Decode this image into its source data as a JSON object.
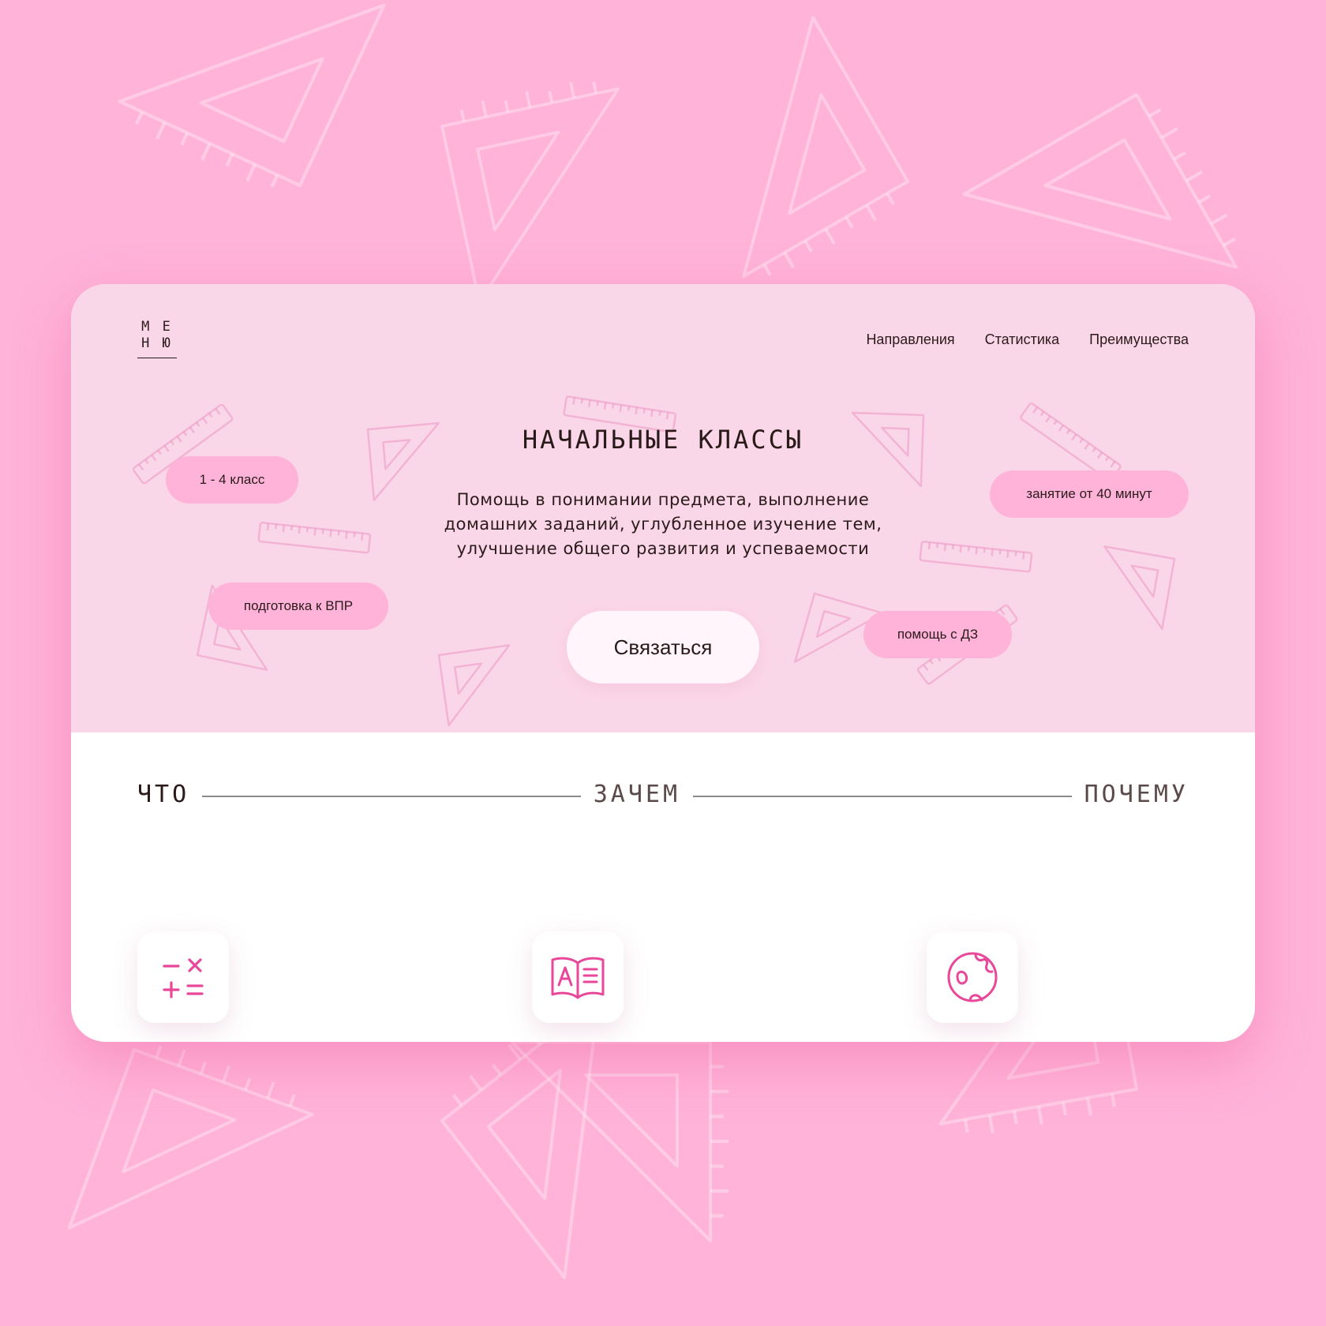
{
  "logo": {
    "line1": "М Е",
    "line2": "Н Ю"
  },
  "nav": {
    "items": [
      "Направления",
      "Статистика",
      "Преимущества"
    ]
  },
  "hero": {
    "title": "НАЧАЛЬНЫЕ КЛАССЫ",
    "description": "Помощь в понимании предмета, выполнение домашних заданий, углубленное изучение тем, улучшение общего развития и успеваемости",
    "contact_label": "Связаться",
    "tags": [
      "1 - 4 класс",
      "подготовка к ВПР",
      "занятие от 40 минут",
      "помощь с ДЗ"
    ]
  },
  "steps": [
    "ЧТО",
    "ЗАЧЕМ",
    "ПОЧЕМУ"
  ],
  "icons": [
    "math-operations-icon",
    "open-book-icon",
    "globe-icon"
  ],
  "colors": {
    "background": "#ffb3d9",
    "hero_background": "#fad7e8",
    "tag": "#ffb3d9",
    "accent_icon": "#e8479a",
    "text": "#2a1a1a"
  }
}
